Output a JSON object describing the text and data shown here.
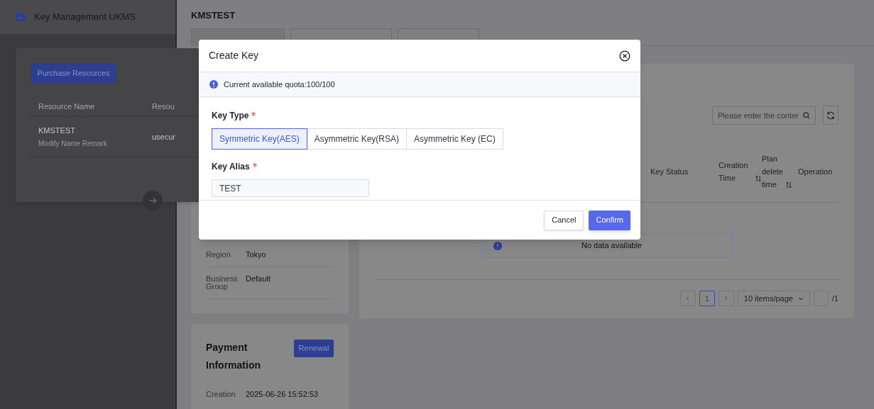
{
  "sidebar": {
    "title": "Key Management UKMS",
    "purchase_button": "Purchase Resources",
    "columns": [
      "Resource Name",
      "Resou"
    ],
    "rows": [
      {
        "name": "KMSTEST",
        "remark": "Modify Name Remark",
        "column_2": "usecur"
      }
    ]
  },
  "drawer": {
    "title": "KMSTEST",
    "details": [
      {
        "label": "Region",
        "value": "Tokyo"
      },
      {
        "label": "Business Group",
        "value": "Default"
      }
    ],
    "payment": {
      "title": "Payment Information",
      "button": "Renewal",
      "rows": [
        {
          "label": "Creation",
          "value": "2025-06-26 15:52:53"
        }
      ]
    },
    "keys": {
      "search": {
        "placeholder": "Please enter the conter"
      },
      "columns": [
        {
          "label": "Key Status",
          "sortable": false
        },
        {
          "label": "Creation Time",
          "sortable": true
        },
        {
          "label": "Plan delete time",
          "sortable": true
        },
        {
          "label": "Operation",
          "sortable": false
        }
      ],
      "empty": "No data available",
      "pagination": {
        "pages": [
          {
            "label": "1",
            "selected": true
          }
        ],
        "page_size": "10 items/page",
        "total": "/1"
      }
    }
  },
  "dialog": {
    "title": "Create Key",
    "notice": "Current available quota:100/100",
    "fields": [
      {
        "kind": "segmented",
        "label": "Key Type",
        "required": true,
        "options": [
          {
            "label": "Symmetric Key(AES)",
            "selected": true
          },
          {
            "label": "Asymmetric Key(RSA)",
            "selected": false
          },
          {
            "label": "Asymmetric Key (EC)",
            "selected": false
          }
        ]
      },
      {
        "kind": "text",
        "label": "Key Alias",
        "required": true,
        "value": "TEST"
      }
    ],
    "buttons": [
      {
        "label": "Cancel",
        "kind": "secondary"
      },
      {
        "label": "Confirm",
        "kind": "primary"
      }
    ]
  }
}
